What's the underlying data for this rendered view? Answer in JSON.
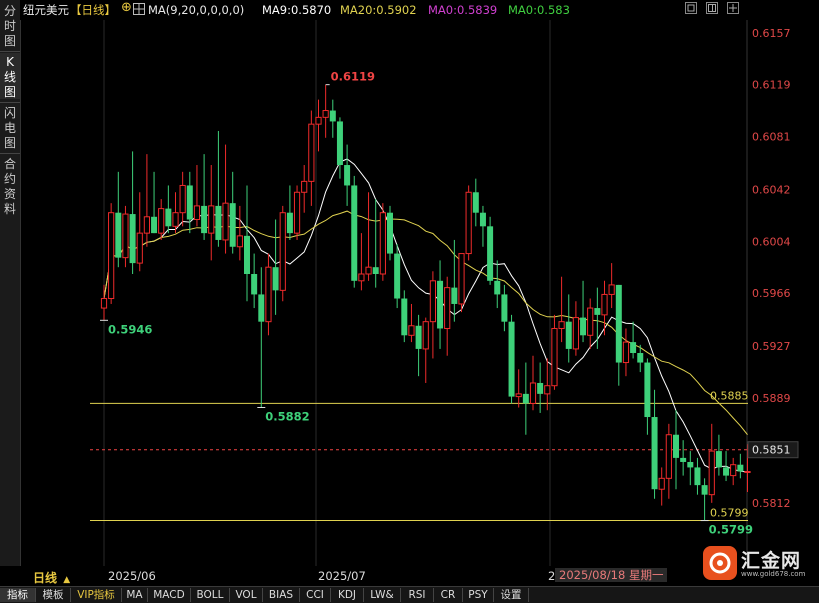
{
  "left_tabs": [
    {
      "label": "分时图",
      "active": false
    },
    {
      "label": "K线图",
      "active": true
    },
    {
      "label": "闪电图",
      "active": false
    },
    {
      "label": "合约资料",
      "active": false
    }
  ],
  "header": {
    "symbol": "纽元美元",
    "period": "【日线】",
    "ma_params": "MA(9,20,0,0,0,0)",
    "ma9": "MA9:0.5870",
    "ma20": "MA20:0.5902",
    "ma0a": "MA0:0.5839",
    "ma0b": "MA0:0.583",
    "colors": {
      "ma9": "#ffffff",
      "ma20": "#e0d250",
      "ma0a": "#d040d0",
      "ma0b": "#40d040"
    }
  },
  "bottom": {
    "period_label": "日线",
    "date_labels": [
      "2025/06",
      "2025/07",
      "2"
    ],
    "cursor_date": "2025/08/18 星期一"
  },
  "indicator_tabs": [
    "指标",
    "模板",
    "VIP指标",
    "MA",
    "MACD",
    "BOLL",
    "VOL",
    "BIAS",
    "CCI",
    "KDJ",
    "LW&",
    "RSI",
    "CR",
    "PSY",
    "设置"
  ],
  "logo": {
    "text": "汇金网",
    "url_text": "www.gold678.com"
  },
  "chart_data": {
    "type": "candlestick",
    "y_ticks": [
      "0.6157",
      "0.6119",
      "0.6081",
      "0.6042",
      "0.6004",
      "0.5966",
      "0.5927",
      "0.5889",
      "0.5851",
      "0.5812"
    ],
    "y_range": [
      0.5795,
      0.6165
    ],
    "colors": {
      "up": "#ef2b2b",
      "down": "#3ed17a",
      "ma9": "#ffffff",
      "ma20": "#e0d250",
      "hline": "#e0d250",
      "dashed": "#ef4444"
    },
    "annotations": [
      {
        "label": "0.6119",
        "price": 0.6119,
        "index": 31,
        "color": "#ef4444"
      },
      {
        "label": "0.5946",
        "price": 0.5946,
        "index": 0,
        "color": "#3ed17a"
      },
      {
        "label": "0.5882",
        "price": 0.5882,
        "index": 22,
        "color": "#3ed17a"
      },
      {
        "label": "0.5799",
        "price": 0.5799,
        "index": 84,
        "color": "#3ed17a"
      }
    ],
    "hlines": [
      {
        "price": 0.5885,
        "label": "0.5885"
      },
      {
        "price": 0.5799,
        "label": "0.5799"
      }
    ],
    "dashed_price": {
      "price": 0.5851,
      "label": "0.5851"
    },
    "candles": [
      {
        "o": 0.5955,
        "h": 0.5972,
        "l": 0.5946,
        "c": 0.5962
      },
      {
        "o": 0.5962,
        "h": 0.6032,
        "l": 0.5958,
        "c": 0.6025
      },
      {
        "o": 0.6025,
        "h": 0.6055,
        "l": 0.5985,
        "c": 0.5992
      },
      {
        "o": 0.5992,
        "h": 0.603,
        "l": 0.5985,
        "c": 0.6024
      },
      {
        "o": 0.6024,
        "h": 0.607,
        "l": 0.598,
        "c": 0.5988
      },
      {
        "o": 0.5988,
        "h": 0.604,
        "l": 0.5982,
        "c": 0.601
      },
      {
        "o": 0.601,
        "h": 0.6068,
        "l": 0.6,
        "c": 0.6022
      },
      {
        "o": 0.6022,
        "h": 0.6055,
        "l": 0.601,
        "c": 0.601
      },
      {
        "o": 0.601,
        "h": 0.6035,
        "l": 0.6005,
        "c": 0.6028
      },
      {
        "o": 0.6028,
        "h": 0.6045,
        "l": 0.601,
        "c": 0.6015
      },
      {
        "o": 0.6015,
        "h": 0.604,
        "l": 0.601,
        "c": 0.6025
      },
      {
        "o": 0.6025,
        "h": 0.6055,
        "l": 0.6015,
        "c": 0.6045
      },
      {
        "o": 0.6045,
        "h": 0.6055,
        "l": 0.601,
        "c": 0.602
      },
      {
        "o": 0.602,
        "h": 0.606,
        "l": 0.6015,
        "c": 0.603
      },
      {
        "o": 0.603,
        "h": 0.6068,
        "l": 0.6005,
        "c": 0.601
      },
      {
        "o": 0.601,
        "h": 0.606,
        "l": 0.599,
        "c": 0.603
      },
      {
        "o": 0.603,
        "h": 0.6085,
        "l": 0.6,
        "c": 0.6005
      },
      {
        "o": 0.6005,
        "h": 0.6075,
        "l": 0.5995,
        "c": 0.6032
      },
      {
        "o": 0.6032,
        "h": 0.6055,
        "l": 0.5995,
        "c": 0.6
      },
      {
        "o": 0.6,
        "h": 0.603,
        "l": 0.599,
        "c": 0.6008
      },
      {
        "o": 0.6008,
        "h": 0.6045,
        "l": 0.596,
        "c": 0.598
      },
      {
        "o": 0.598,
        "h": 0.5995,
        "l": 0.5955,
        "c": 0.5965
      },
      {
        "o": 0.5965,
        "h": 0.5985,
        "l": 0.5882,
        "c": 0.5945
      },
      {
        "o": 0.5945,
        "h": 0.5995,
        "l": 0.5935,
        "c": 0.5985
      },
      {
        "o": 0.5985,
        "h": 0.602,
        "l": 0.595,
        "c": 0.5968
      },
      {
        "o": 0.5968,
        "h": 0.603,
        "l": 0.596,
        "c": 0.6025
      },
      {
        "o": 0.6025,
        "h": 0.6045,
        "l": 0.6005,
        "c": 0.601
      },
      {
        "o": 0.601,
        "h": 0.6045,
        "l": 0.6005,
        "c": 0.604
      },
      {
        "o": 0.604,
        "h": 0.606,
        "l": 0.6025,
        "c": 0.6048
      },
      {
        "o": 0.6048,
        "h": 0.61,
        "l": 0.603,
        "c": 0.609
      },
      {
        "o": 0.609,
        "h": 0.6108,
        "l": 0.607,
        "c": 0.6095
      },
      {
        "o": 0.6095,
        "h": 0.6119,
        "l": 0.608,
        "c": 0.61
      },
      {
        "o": 0.61,
        "h": 0.6108,
        "l": 0.608,
        "c": 0.6092
      },
      {
        "o": 0.6092,
        "h": 0.6095,
        "l": 0.605,
        "c": 0.606
      },
      {
        "o": 0.606,
        "h": 0.6075,
        "l": 0.603,
        "c": 0.6045
      },
      {
        "o": 0.6045,
        "h": 0.6052,
        "l": 0.597,
        "c": 0.5975
      },
      {
        "o": 0.5975,
        "h": 0.601,
        "l": 0.5968,
        "c": 0.598
      },
      {
        "o": 0.598,
        "h": 0.604,
        "l": 0.5975,
        "c": 0.5985
      },
      {
        "o": 0.5985,
        "h": 0.6035,
        "l": 0.597,
        "c": 0.598
      },
      {
        "o": 0.598,
        "h": 0.6032,
        "l": 0.5975,
        "c": 0.6025
      },
      {
        "o": 0.6025,
        "h": 0.603,
        "l": 0.599,
        "c": 0.5995
      },
      {
        "o": 0.5995,
        "h": 0.6002,
        "l": 0.5955,
        "c": 0.5962
      },
      {
        "o": 0.5962,
        "h": 0.5968,
        "l": 0.593,
        "c": 0.5935
      },
      {
        "o": 0.5935,
        "h": 0.5958,
        "l": 0.593,
        "c": 0.5942
      },
      {
        "o": 0.5942,
        "h": 0.595,
        "l": 0.5905,
        "c": 0.5925
      },
      {
        "o": 0.5925,
        "h": 0.5948,
        "l": 0.59,
        "c": 0.5945
      },
      {
        "o": 0.5945,
        "h": 0.5982,
        "l": 0.5918,
        "c": 0.5975
      },
      {
        "o": 0.5975,
        "h": 0.599,
        "l": 0.5925,
        "c": 0.594
      },
      {
        "o": 0.594,
        "h": 0.5978,
        "l": 0.592,
        "c": 0.597
      },
      {
        "o": 0.597,
        "h": 0.6005,
        "l": 0.5945,
        "c": 0.5958
      },
      {
        "o": 0.5958,
        "h": 0.5995,
        "l": 0.5952,
        "c": 0.5995
      },
      {
        "o": 0.5995,
        "h": 0.6045,
        "l": 0.599,
        "c": 0.604
      },
      {
        "o": 0.604,
        "h": 0.605,
        "l": 0.6015,
        "c": 0.6025
      },
      {
        "o": 0.6025,
        "h": 0.603,
        "l": 0.6,
        "c": 0.6015
      },
      {
        "o": 0.6015,
        "h": 0.6022,
        "l": 0.5972,
        "c": 0.5975
      },
      {
        "o": 0.5975,
        "h": 0.599,
        "l": 0.5955,
        "c": 0.5965
      },
      {
        "o": 0.5965,
        "h": 0.5972,
        "l": 0.5938,
        "c": 0.5945
      },
      {
        "o": 0.5945,
        "h": 0.595,
        "l": 0.5885,
        "c": 0.589
      },
      {
        "o": 0.589,
        "h": 0.591,
        "l": 0.5882,
        "c": 0.5892
      },
      {
        "o": 0.5892,
        "h": 0.5915,
        "l": 0.5862,
        "c": 0.5885
      },
      {
        "o": 0.5885,
        "h": 0.592,
        "l": 0.588,
        "c": 0.59
      },
      {
        "o": 0.59,
        "h": 0.5915,
        "l": 0.5878,
        "c": 0.5892
      },
      {
        "o": 0.5892,
        "h": 0.5918,
        "l": 0.588,
        "c": 0.5898
      },
      {
        "o": 0.5898,
        "h": 0.595,
        "l": 0.5895,
        "c": 0.594
      },
      {
        "o": 0.594,
        "h": 0.5978,
        "l": 0.593,
        "c": 0.5945
      },
      {
        "o": 0.5945,
        "h": 0.5965,
        "l": 0.5915,
        "c": 0.5925
      },
      {
        "o": 0.5925,
        "h": 0.596,
        "l": 0.592,
        "c": 0.5948
      },
      {
        "o": 0.5948,
        "h": 0.5975,
        "l": 0.593,
        "c": 0.5935
      },
      {
        "o": 0.5935,
        "h": 0.5962,
        "l": 0.5925,
        "c": 0.5955
      },
      {
        "o": 0.5955,
        "h": 0.597,
        "l": 0.5925,
        "c": 0.595
      },
      {
        "o": 0.595,
        "h": 0.5975,
        "l": 0.5935,
        "c": 0.5965
      },
      {
        "o": 0.5965,
        "h": 0.5988,
        "l": 0.5955,
        "c": 0.5972
      },
      {
        "o": 0.5972,
        "h": 0.5972,
        "l": 0.5898,
        "c": 0.5915
      },
      {
        "o": 0.5915,
        "h": 0.594,
        "l": 0.5905,
        "c": 0.593
      },
      {
        "o": 0.593,
        "h": 0.5945,
        "l": 0.5918,
        "c": 0.5922
      },
      {
        "o": 0.5922,
        "h": 0.5928,
        "l": 0.5908,
        "c": 0.5915
      },
      {
        "o": 0.5915,
        "h": 0.5918,
        "l": 0.5862,
        "c": 0.5875
      },
      {
        "o": 0.5875,
        "h": 0.5895,
        "l": 0.5815,
        "c": 0.5822
      },
      {
        "o": 0.5822,
        "h": 0.5838,
        "l": 0.581,
        "c": 0.583
      },
      {
        "o": 0.583,
        "h": 0.587,
        "l": 0.5815,
        "c": 0.5862
      },
      {
        "o": 0.5862,
        "h": 0.588,
        "l": 0.5822,
        "c": 0.5845
      },
      {
        "o": 0.5845,
        "h": 0.5858,
        "l": 0.5832,
        "c": 0.5842
      },
      {
        "o": 0.5842,
        "h": 0.585,
        "l": 0.5825,
        "c": 0.5838
      },
      {
        "o": 0.5838,
        "h": 0.5845,
        "l": 0.5818,
        "c": 0.5825
      },
      {
        "o": 0.5825,
        "h": 0.583,
        "l": 0.5799,
        "c": 0.5818
      },
      {
        "o": 0.5818,
        "h": 0.587,
        "l": 0.5812,
        "c": 0.585
      },
      {
        "o": 0.585,
        "h": 0.5862,
        "l": 0.5832,
        "c": 0.5838
      },
      {
        "o": 0.5838,
        "h": 0.585,
        "l": 0.5828,
        "c": 0.5832
      },
      {
        "o": 0.5832,
        "h": 0.5845,
        "l": 0.5825,
        "c": 0.584
      },
      {
        "o": 0.584,
        "h": 0.5848,
        "l": 0.583,
        "c": 0.5835
      },
      {
        "o": 0.5835,
        "h": 0.5855,
        "l": 0.582,
        "c": 0.5835
      }
    ]
  }
}
